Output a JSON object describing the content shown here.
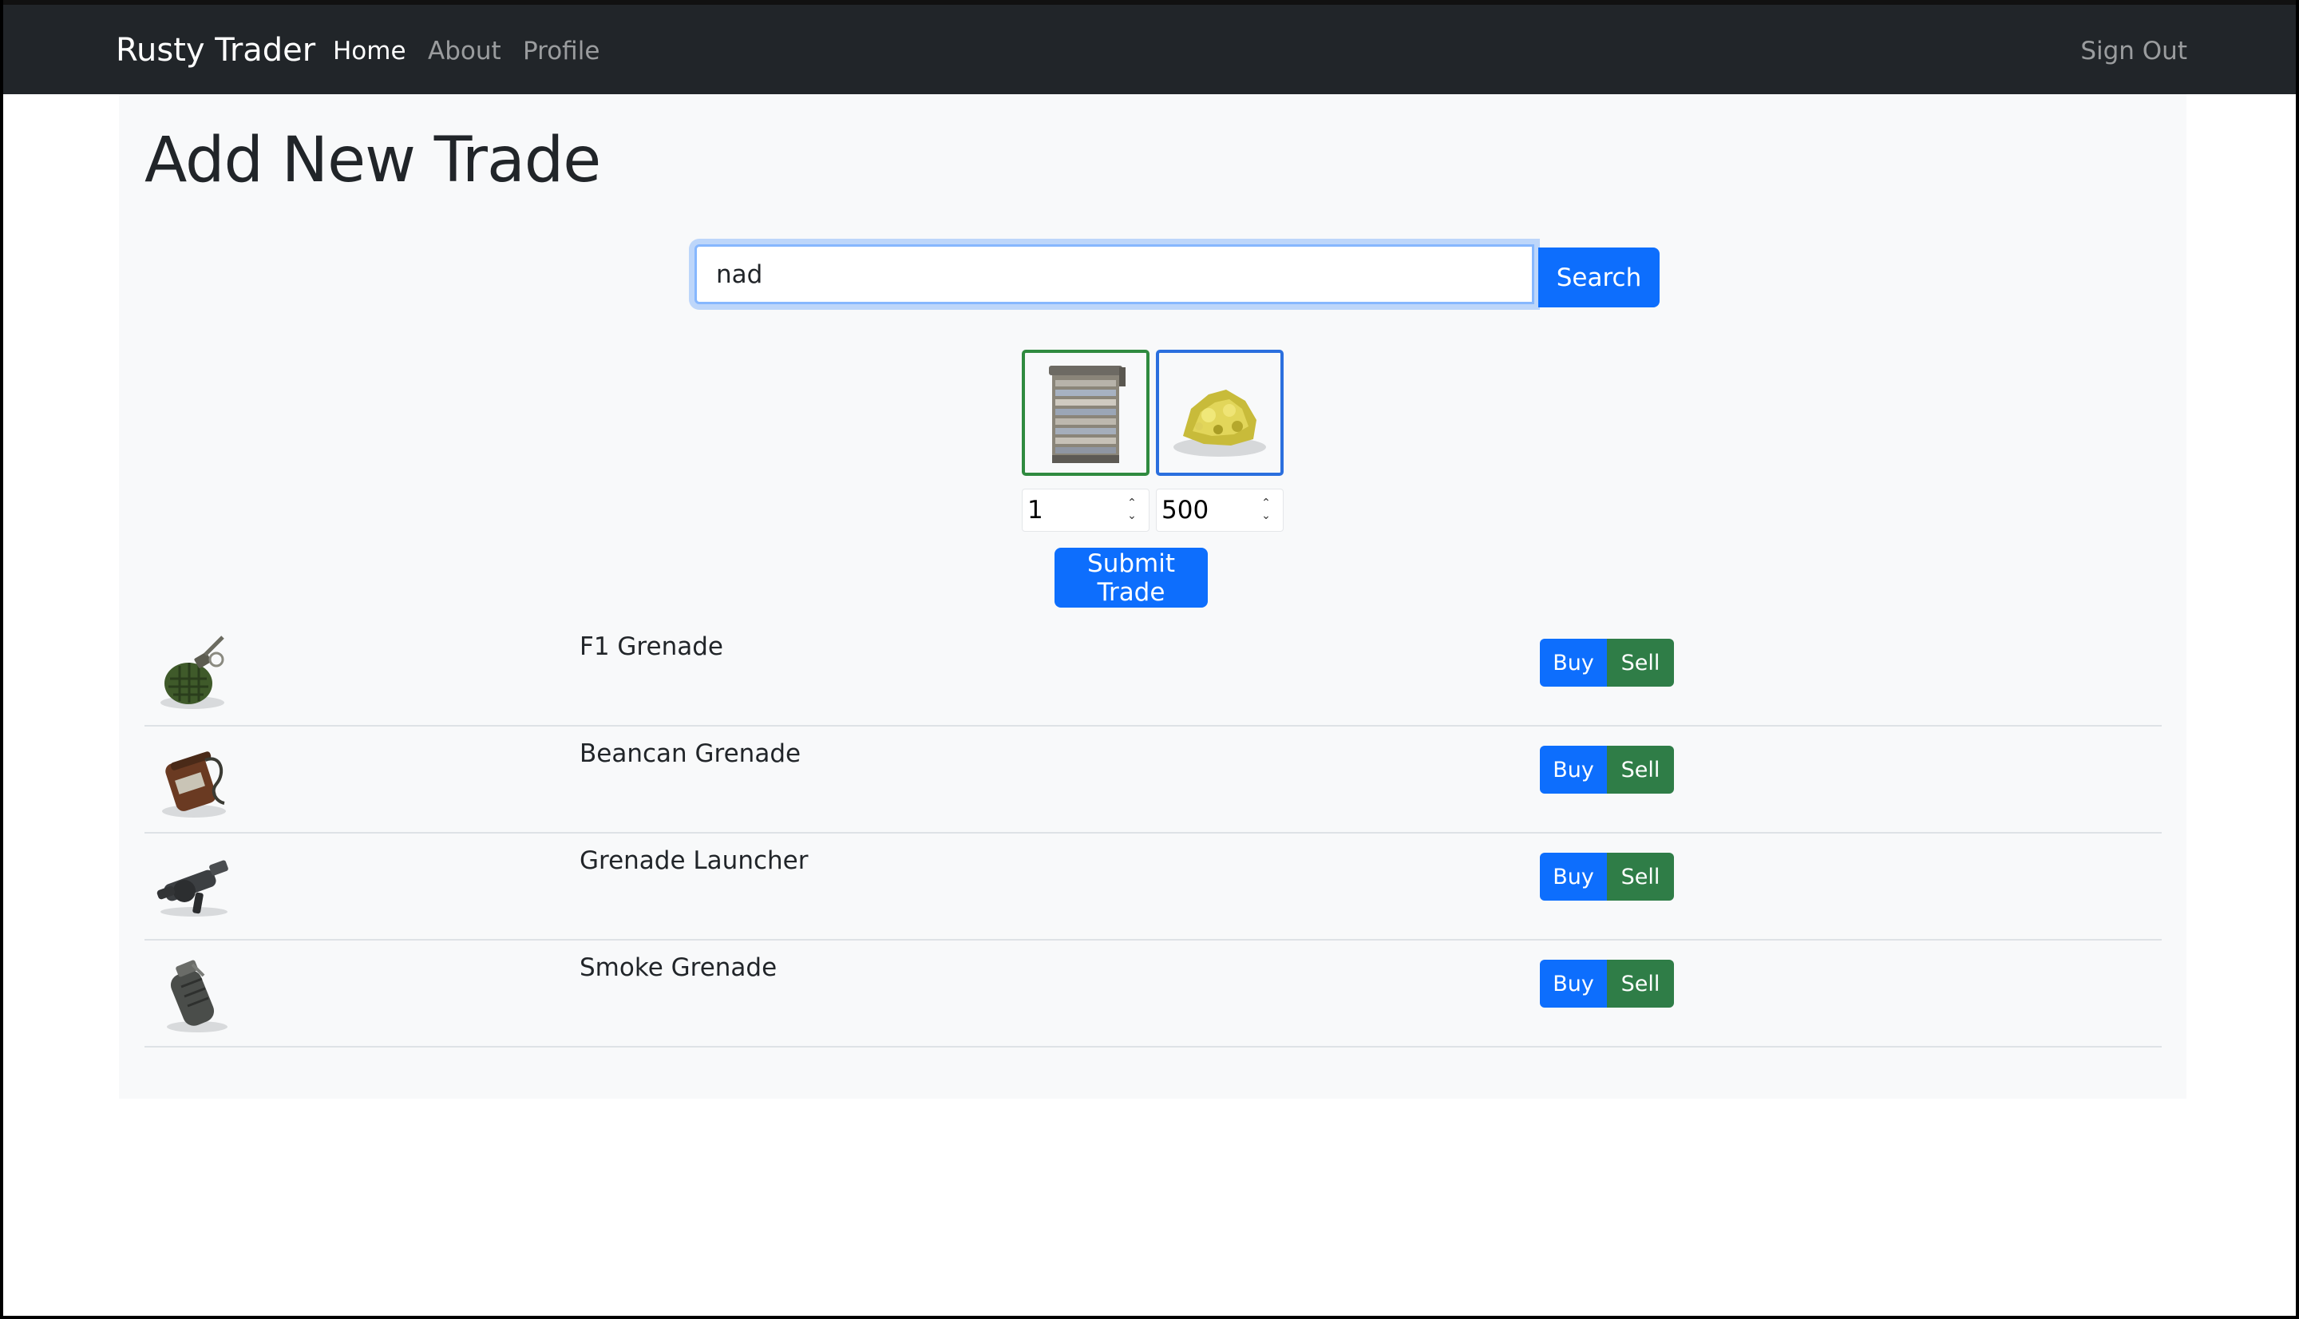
{
  "navbar": {
    "brand": "Rusty Trader",
    "links": [
      {
        "label": "Home",
        "active": true
      },
      {
        "label": "About",
        "active": false
      },
      {
        "label": "Profile",
        "active": false
      }
    ],
    "sign_out": "Sign Out"
  },
  "page": {
    "title": "Add New Trade"
  },
  "search": {
    "value": "nad",
    "button_label": "Search"
  },
  "trade": {
    "offer": {
      "icon": "garage-door-icon",
      "quantity": "1",
      "border_color": "#2f8a3f"
    },
    "request": {
      "icon": "sulfur-ore-icon",
      "quantity": "500",
      "border_color": "#2b6fde"
    },
    "submit_label": "Submit Trade"
  },
  "results": [
    {
      "name": "F1 Grenade",
      "icon": "f1-grenade-icon",
      "buy_label": "Buy",
      "sell_label": "Sell"
    },
    {
      "name": "Beancan Grenade",
      "icon": "beancan-grenade-icon",
      "buy_label": "Buy",
      "sell_label": "Sell"
    },
    {
      "name": "Grenade Launcher",
      "icon": "grenade-launcher-icon",
      "buy_label": "Buy",
      "sell_label": "Sell"
    },
    {
      "name": "Smoke Grenade",
      "icon": "smoke-grenade-icon",
      "buy_label": "Buy",
      "sell_label": "Sell"
    }
  ],
  "colors": {
    "navbar_bg": "#212529",
    "primary": "#0d6efd",
    "success": "#2f7d47",
    "panel_bg": "#f8f9fa"
  }
}
